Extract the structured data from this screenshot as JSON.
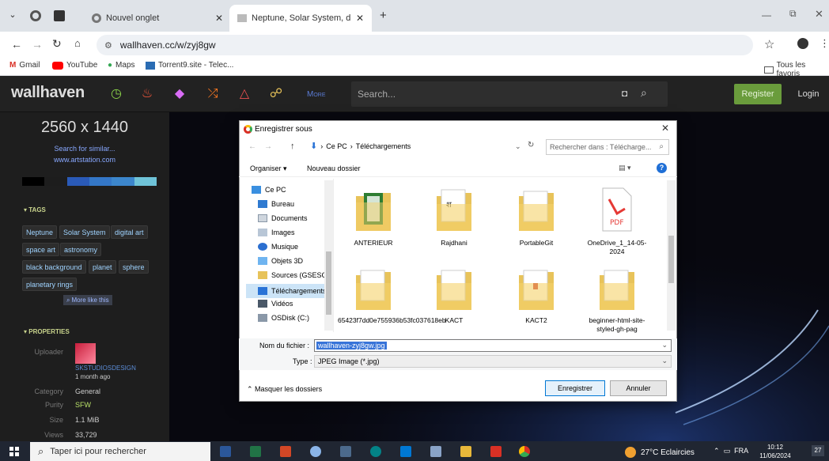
{
  "browser": {
    "tabs": [
      {
        "title": "Nouvel onglet",
        "active": false
      },
      {
        "title": "Neptune, Solar System, digital art",
        "active": true
      }
    ],
    "url": "wallhaven.cc/w/zyj8gw",
    "bookmarks": [
      "Gmail",
      "YouTube",
      "Maps",
      "Torrent9.site - Telec...",
      "Tous les favoris"
    ]
  },
  "site": {
    "logo": "wallhaven",
    "nav_more": "More",
    "search_placeholder": "Search...",
    "register": "Register",
    "login": "Login"
  },
  "sidebar": {
    "resolution": "2560 x 1440",
    "similar_link": "Search for similar...",
    "source_link": "www.artstation.com",
    "palette": [
      "#000000",
      "#1d1d1d",
      "#2a5ab8",
      "#3477c7",
      "#3c86cc",
      "#6fc3d8"
    ],
    "tags_heading": "TAGS",
    "tags": [
      "Neptune",
      "Solar System",
      "digital art",
      "space art",
      "astronomy",
      "black background",
      "planet",
      "sphere",
      "planetary rings"
    ],
    "more_like_this": "More like this",
    "properties_heading": "PROPERTIES",
    "uploader_label": "Uploader",
    "uploader_name": "SKSTUDIOSDESIGN",
    "uploaded_ago": "1 month ago",
    "properties": [
      {
        "key": "Category",
        "value": "General"
      },
      {
        "key": "Purity",
        "value": "SFW"
      },
      {
        "key": "Size",
        "value": "1.1 MiB"
      },
      {
        "key": "Views",
        "value": "33,729"
      }
    ]
  },
  "dialog": {
    "title": "Enregistrer sous",
    "breadcrumb": [
      "Ce PC",
      "Téléchargements"
    ],
    "search_placeholder": "Rechercher dans : Télécharge...",
    "organize": "Organiser",
    "new_folder": "Nouveau dossier",
    "nav_items": [
      "Ce PC",
      "Bureau",
      "Documents",
      "Images",
      "Musique",
      "Objets 3D",
      "Sources (GSESCC",
      "Téléchargements",
      "Vidéos",
      "OSDisk (C:)"
    ],
    "files": [
      {
        "name": "ANTERIEUR",
        "icon": "folder-excel"
      },
      {
        "name": "Rajdhani",
        "icon": "folder-doc"
      },
      {
        "name": "PortableGit",
        "icon": "folder-plain"
      },
      {
        "name": "OneDrive_1_14-05-2024",
        "icon": "pdf-icon"
      },
      {
        "name": "65423f7dd0e755936b53fc037618eb",
        "icon": "folder-plain"
      },
      {
        "name": "KACT",
        "icon": "folder-doc"
      },
      {
        "name": "KACT2",
        "icon": "folder-red"
      },
      {
        "name": "beginner-html-site-styled-gh-pag",
        "icon": "folder-doc"
      }
    ],
    "filename_label": "Nom du fichier :",
    "filename_value": "wallhaven-zyj8gw.jpg",
    "type_label": "Type :",
    "type_value": "JPEG Image (*.jpg)",
    "hide_folders": "Masquer les dossiers",
    "save": "Enregistrer",
    "cancel": "Annuler"
  },
  "taskbar": {
    "search_placeholder": "Taper ici pour rechercher",
    "weather": "27°C Eclaircies",
    "lang": "FRA",
    "time": "10:12",
    "date": "11/06/2024",
    "notif_count": "27"
  }
}
